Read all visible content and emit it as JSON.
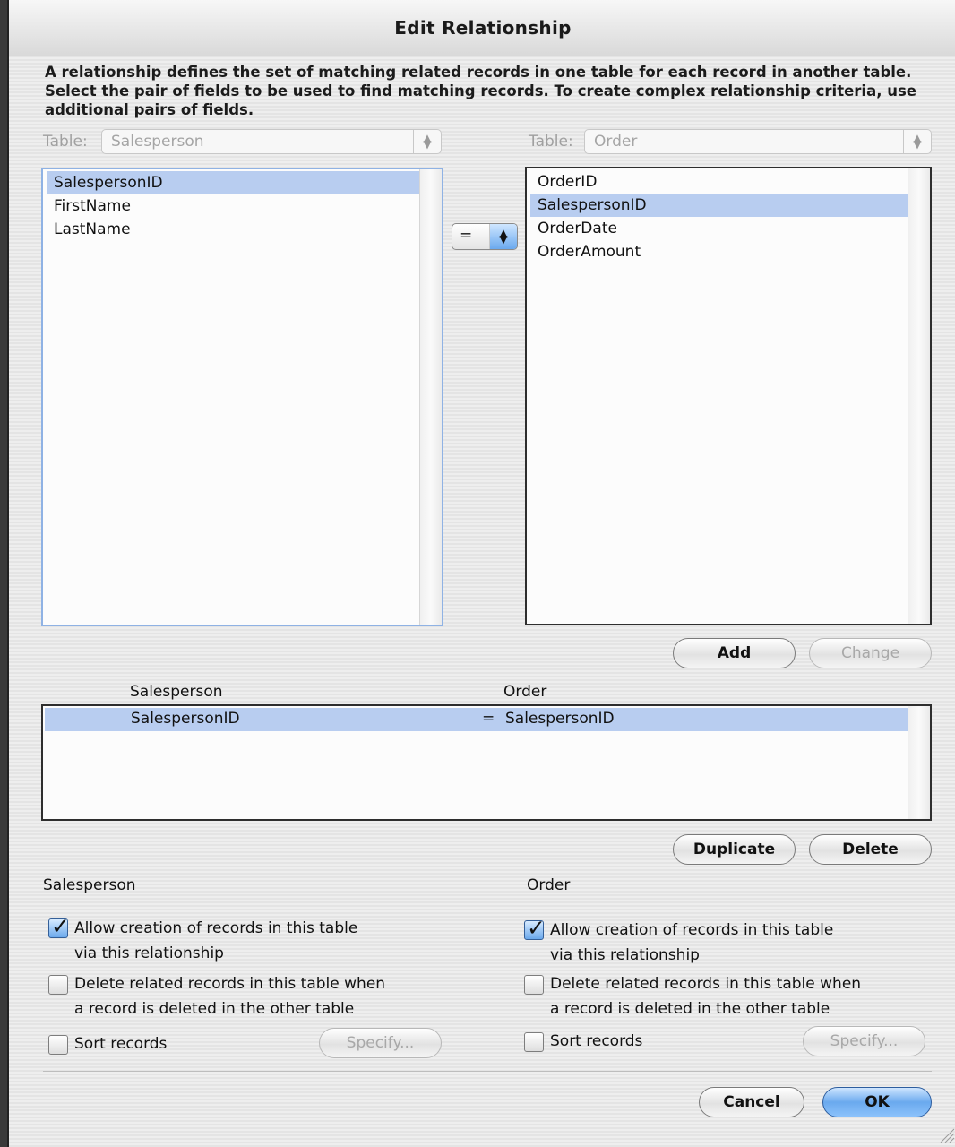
{
  "dialog": {
    "title": "Edit Relationship"
  },
  "description": "A relationship defines the set of matching related records in one table for each record in another table. Select the pair of fields to be used to find matching records. To create complex relationship criteria, use additional pairs of fields.",
  "left_table": {
    "label": "Table:",
    "selected": "Salesperson",
    "fields": [
      "SalespersonID",
      "FirstName",
      "LastName"
    ],
    "selected_field": "SalespersonID"
  },
  "right_table": {
    "label": "Table:",
    "selected": "Order",
    "fields": [
      "OrderID",
      "SalespersonID",
      "OrderDate",
      "OrderAmount"
    ],
    "selected_field": "SalespersonID"
  },
  "operator": {
    "value": "="
  },
  "buttons": {
    "add": "Add",
    "change": "Change",
    "duplicate": "Duplicate",
    "delete": "Delete",
    "specify": "Specify...",
    "cancel": "Cancel",
    "ok": "OK"
  },
  "criteria": {
    "headers": {
      "left": "Salesperson",
      "right": "Order"
    },
    "rows": [
      {
        "left": "SalespersonID",
        "op": "=",
        "right": "SalespersonID"
      }
    ]
  },
  "options": {
    "left": {
      "title": "Salesperson",
      "allow_creation": {
        "line1": "Allow creation of records in this table",
        "line2": "via this relationship",
        "checked": true
      },
      "delete_related": {
        "line1": "Delete related records in this table when",
        "line2": "a record is deleted in the other table",
        "checked": false
      },
      "sort_records": {
        "label": "Sort records",
        "checked": false
      }
    },
    "right": {
      "title": "Order",
      "allow_creation": {
        "line1": "Allow creation of records in this table",
        "line2": "via this relationship",
        "checked": true
      },
      "delete_related": {
        "line1": "Delete related records in this table when",
        "line2": "a record is deleted in the other table",
        "checked": false
      },
      "sort_records": {
        "label": "Sort records",
        "checked": false
      }
    }
  },
  "icons": {
    "updown": "updown-arrows-icon",
    "check": "checkmark-icon",
    "resize": "resize-grip-icon"
  },
  "colors": {
    "selection": "#b8cdf0",
    "default_button": "#6aa9ee"
  }
}
